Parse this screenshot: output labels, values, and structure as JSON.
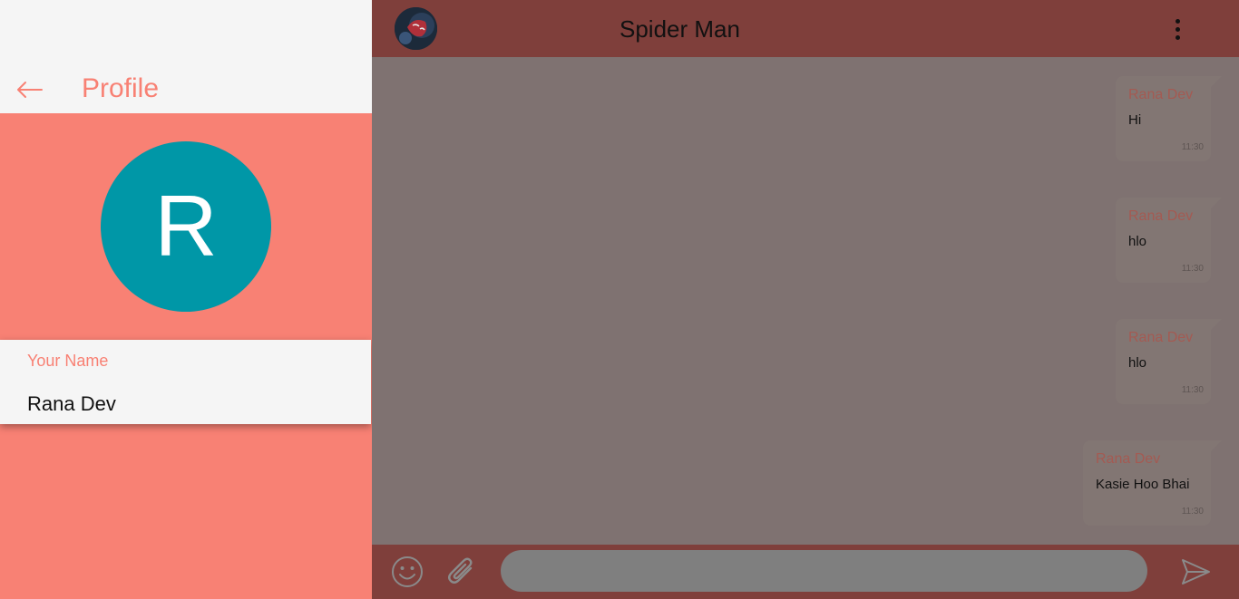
{
  "profile": {
    "title": "Profile",
    "avatar_initial": "R",
    "name_label": "Your Name",
    "name_value": "Rana Dev"
  },
  "chat": {
    "contact_name": "Spider Man",
    "messages": [
      {
        "author": "Rana Dev",
        "text": "Hi",
        "time": "11:30"
      },
      {
        "author": "Rana Dev",
        "text": "hlo",
        "time": "11:30"
      },
      {
        "author": "Rana Dev",
        "text": "hlo",
        "time": "11:30"
      },
      {
        "author": "Rana Dev",
        "text": "Kasie Hoo Bhai",
        "time": "11:30"
      }
    ],
    "input": {
      "value": "",
      "placeholder": ""
    }
  },
  "icons": {
    "back": "arrow-left-icon",
    "menu": "more-vertical-icon",
    "emoji": "smiley-icon",
    "attach": "paperclip-icon",
    "send": "send-icon"
  },
  "colors": {
    "accent": "#f88174",
    "avatar": "#0097a7",
    "header": "#7f3f3b",
    "chat_background": "#7f7271",
    "author": "#a45a52"
  }
}
